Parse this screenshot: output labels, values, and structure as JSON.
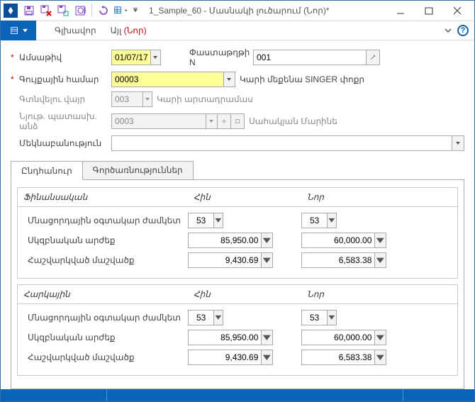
{
  "window": {
    "title": "1_Sample_60 - Մասնակի լուծարում (Նոր)*"
  },
  "menubar": {
    "item1": "Գլխավոր",
    "item2": "Այլ",
    "new_suffix": "(Նոր)"
  },
  "form": {
    "date_label": "Ամսաթիվ",
    "date_value": "01/07/17",
    "docnum_label": "Փաստաթղթի N",
    "docnum_value": "001",
    "asset_label": "Գույքային համար",
    "asset_value": "00003",
    "asset_desc": "Կարի մեքենա SINGER փոքր",
    "location_label": "Գտնվելու վայր",
    "location_value": "003",
    "location_desc": "Կարի արտադրամաս",
    "responsible_label": "Նյութ. պատասխ. անձ",
    "responsible_value": "0003",
    "responsible_desc": "Սահակյան Մարինե",
    "comment_label": "Մեկնաբանություն",
    "comment_value": ""
  },
  "tabs": {
    "general": "Ընդհանուր",
    "operations": "Գործառնություններ"
  },
  "section_fin": {
    "title": "Ֆինանսական",
    "col_old": "Հին",
    "col_new": "Նոր",
    "row_remaining": "Մնացորդային օգտակար ժամկետ",
    "row_initial": "Սկզբնական արժեք",
    "row_accdep": "Հաշվարկված մաշվածք",
    "v_remaining_old": "53",
    "v_remaining_new": "53",
    "v_initial_old": "85,950.00",
    "v_initial_new": "60,000.00",
    "v_accdep_old": "9,430.69",
    "v_accdep_new": "6,583.38"
  },
  "section_tax": {
    "title": "Հարկային",
    "col_old": "Հին",
    "col_new": "Նոր",
    "row_remaining": "Մնացորդային օգտակար ժամկետ",
    "row_initial": "Սկզբնական արժեք",
    "row_accdep": "Հաշվարկված մաշվածք",
    "v_remaining_old": "53",
    "v_remaining_new": "53",
    "v_initial_old": "85,950.00",
    "v_initial_new": "60,000.00",
    "v_accdep_old": "9,430.69",
    "v_accdep_new": "6,583.38"
  }
}
